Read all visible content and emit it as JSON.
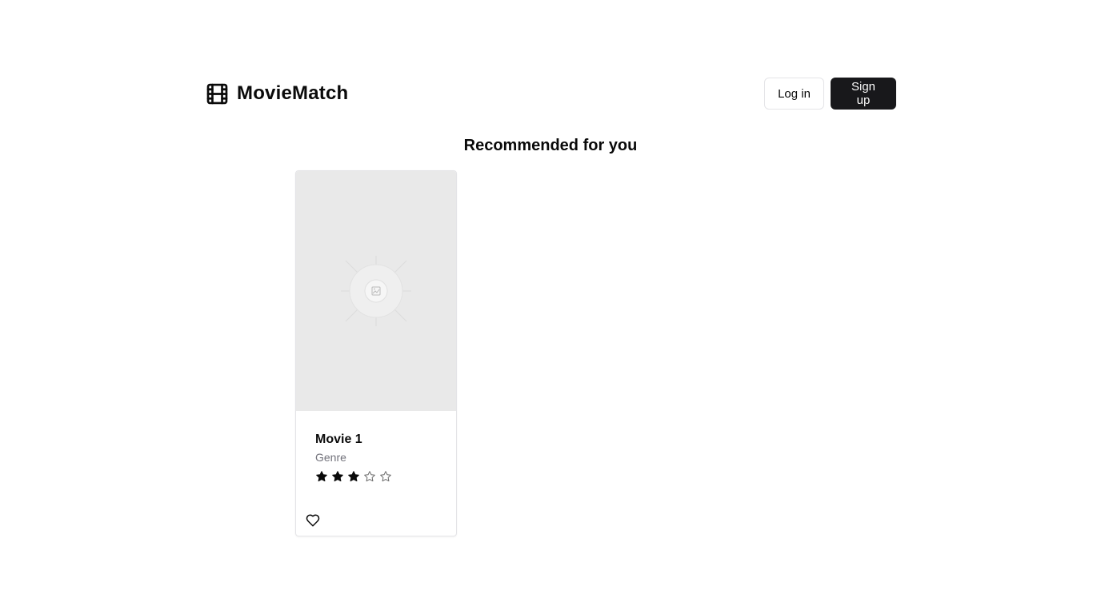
{
  "header": {
    "brand_name": "MovieMatch",
    "brand_icon": "film-icon",
    "login_label": "Log in",
    "signup_label": "Sign up"
  },
  "section": {
    "title": "Recommended for you"
  },
  "movies": [
    {
      "title": "Movie 1",
      "genre": "Genre",
      "rating": 3,
      "rating_max": 5,
      "poster_icon": "image-placeholder-icon",
      "favorite_icon": "heart-icon"
    }
  ],
  "colors": {
    "primary": "#18181b",
    "muted_text": "#71717a",
    "border": "#e4e4e7",
    "poster_bg": "#e9e9e9"
  }
}
